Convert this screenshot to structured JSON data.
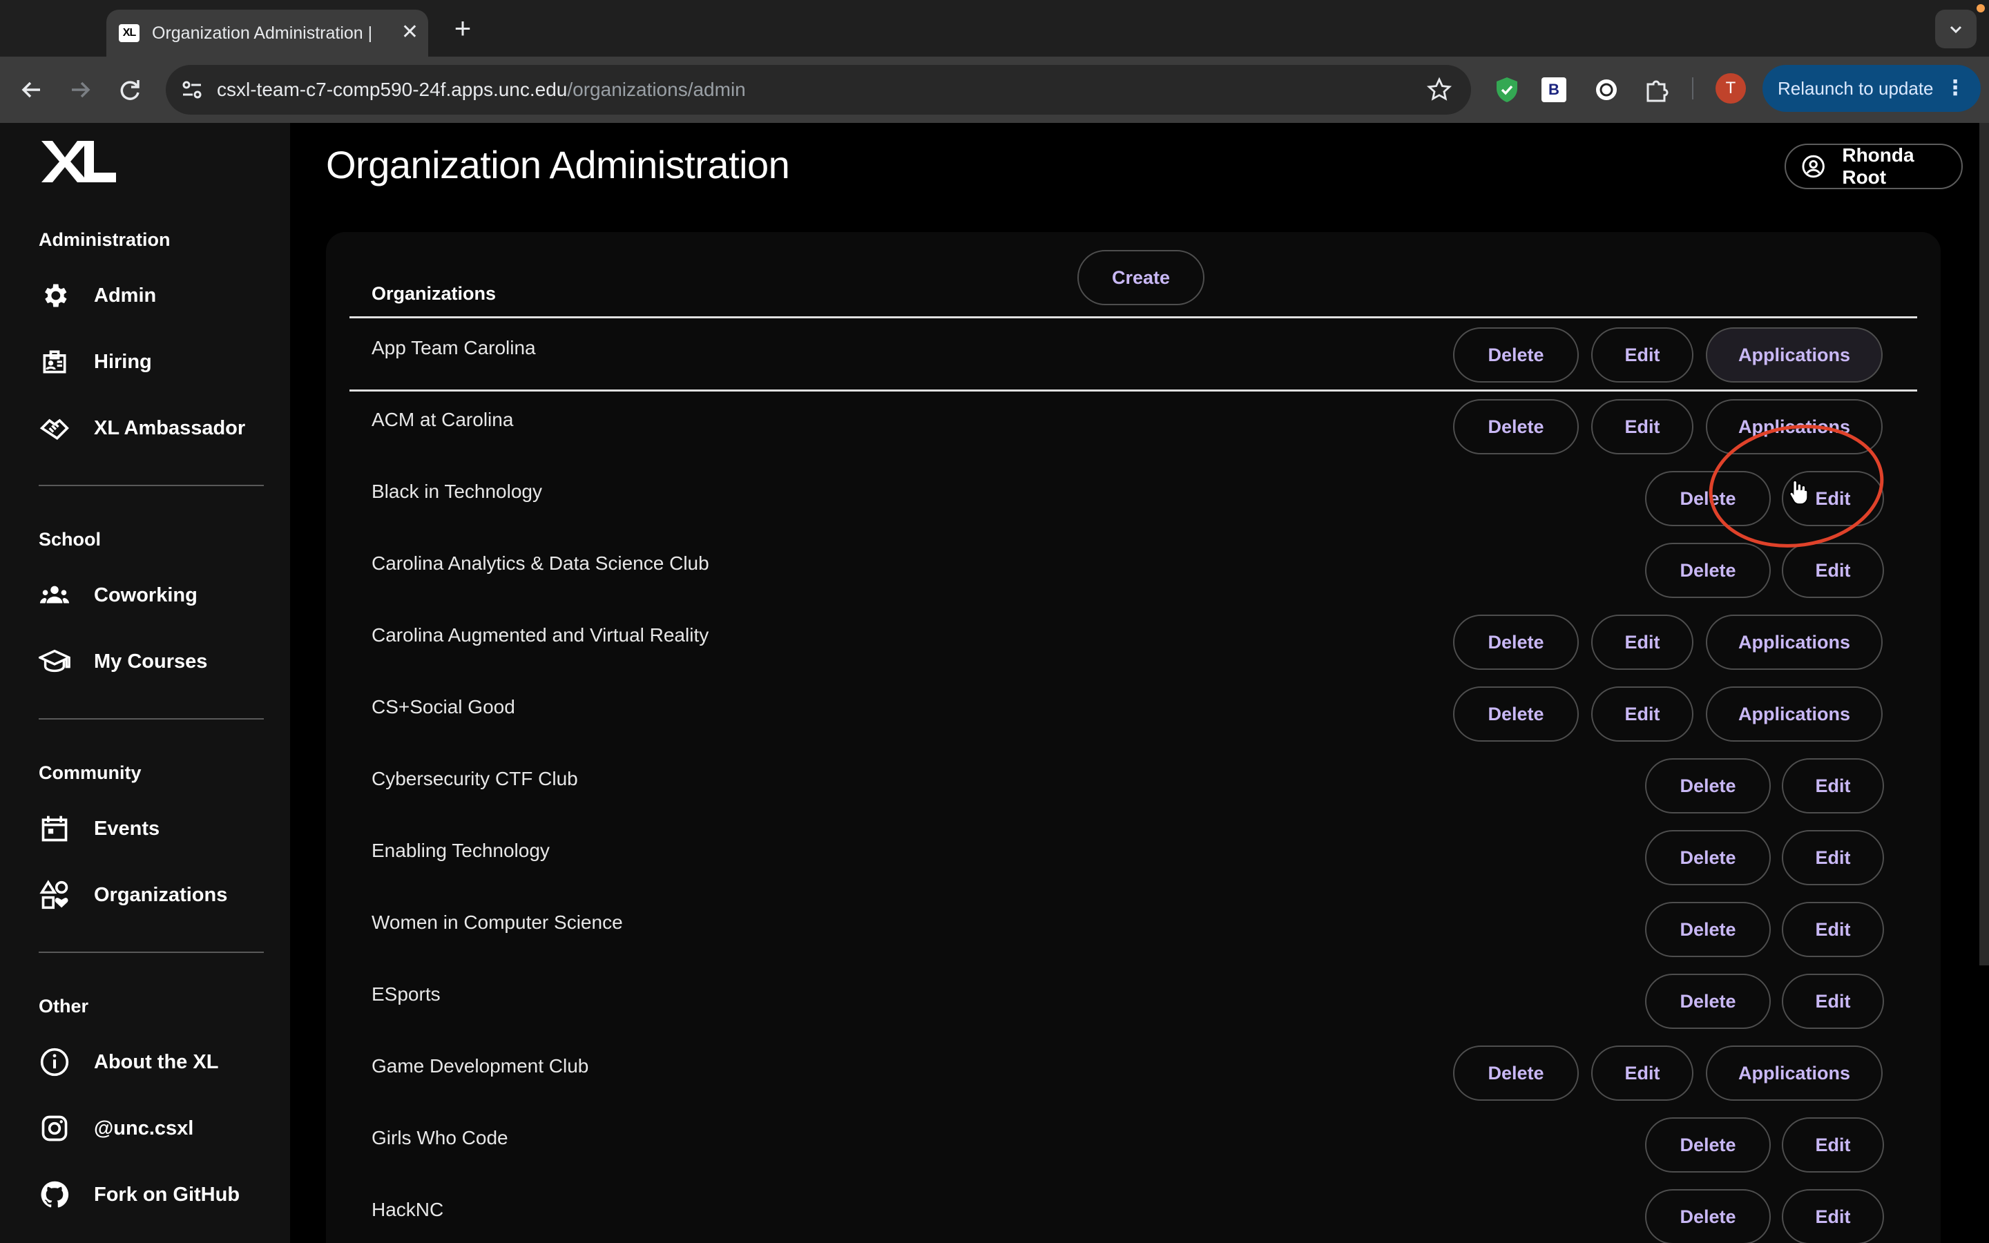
{
  "browser": {
    "tab_title": "Organization Administration |",
    "tab_favicon_text": "XL",
    "new_tab_label": "+",
    "url_host": "csxl-team-c7-comp590-24f.apps.unc.edu",
    "url_path": "/organizations/admin",
    "profile_initial": "T",
    "relaunch_label": "Relaunch to update",
    "extension_b_label": "B"
  },
  "sidebar": {
    "sections": [
      {
        "title": "Administration",
        "items": [
          {
            "label": "Admin",
            "icon": "gear-icon"
          },
          {
            "label": "Hiring",
            "icon": "badge-icon"
          },
          {
            "label": "XL Ambassador",
            "icon": "handshake-icon"
          }
        ]
      },
      {
        "title": "School",
        "items": [
          {
            "label": "Coworking",
            "icon": "groups-icon"
          },
          {
            "label": "My Courses",
            "icon": "graduation-cap-icon"
          }
        ]
      },
      {
        "title": "Community",
        "items": [
          {
            "label": "Events",
            "icon": "calendar-icon"
          },
          {
            "label": "Organizations",
            "icon": "shapes-icon"
          }
        ]
      },
      {
        "title": "Other",
        "items": [
          {
            "label": "About the XL",
            "icon": "info-icon"
          },
          {
            "label": "@unc.csxl",
            "icon": "instagram-icon"
          },
          {
            "label": "Fork on GitHub",
            "icon": "github-icon"
          }
        ]
      }
    ]
  },
  "page": {
    "title": "Organization Administration",
    "user_name": "Rhonda Root"
  },
  "card": {
    "header": "Organizations",
    "create_label": "Create",
    "delete_label": "Delete",
    "edit_label": "Edit",
    "applications_label": "Applications",
    "organizations": [
      {
        "name": "App Team Carolina",
        "has_applications": true
      },
      {
        "name": "ACM at Carolina",
        "has_applications": true
      },
      {
        "name": "Black in Technology",
        "has_applications": false
      },
      {
        "name": "Carolina Analytics & Data Science Club",
        "has_applications": false
      },
      {
        "name": "Carolina Augmented and Virtual Reality",
        "has_applications": true
      },
      {
        "name": "CS+Social Good",
        "has_applications": true
      },
      {
        "name": "Cybersecurity CTF Club",
        "has_applications": false
      },
      {
        "name": "Enabling Technology",
        "has_applications": false
      },
      {
        "name": "Women in Computer Science",
        "has_applications": false
      },
      {
        "name": "ESports",
        "has_applications": false
      },
      {
        "name": "Game Development Club",
        "has_applications": true
      },
      {
        "name": "Girls Who Code",
        "has_applications": false
      },
      {
        "name": "HackNC",
        "has_applications": false
      }
    ]
  },
  "colors": {
    "accent_text": "#c9b8f5",
    "annotation": "#e0422a",
    "relaunch_bg": "#0b4c80"
  }
}
